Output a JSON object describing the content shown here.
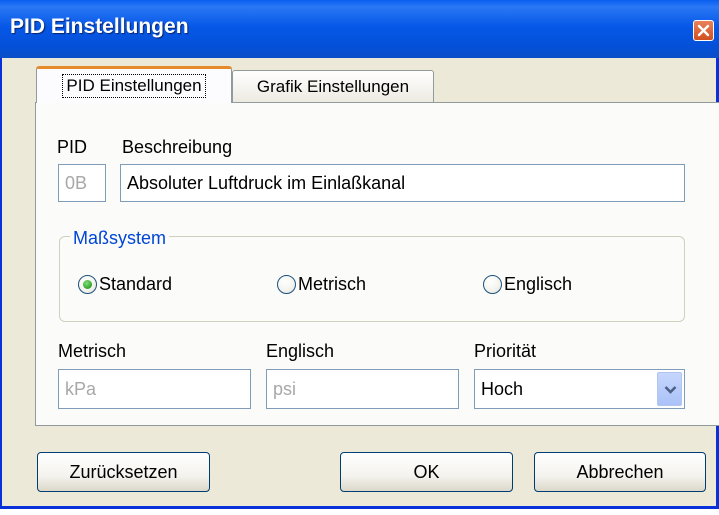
{
  "window": {
    "title": "PID Einstellungen"
  },
  "tabs": [
    {
      "label": "PID Einstellungen",
      "active": true
    },
    {
      "label": "Grafik Einstellungen",
      "active": false
    }
  ],
  "pid": {
    "label": "PID",
    "value": "0B"
  },
  "description": {
    "label": "Beschreibung",
    "value": "Absoluter Luftdruck im Einlaßkanal"
  },
  "measure_system": {
    "legend": "Maßsystem",
    "options": [
      {
        "label": "Standard",
        "selected": true
      },
      {
        "label": "Metrisch",
        "selected": false
      },
      {
        "label": "Englisch",
        "selected": false
      }
    ]
  },
  "units": {
    "metric_label": "Metrisch",
    "metric_value": "kPa",
    "english_label": "Englisch",
    "english_value": "psi"
  },
  "priority": {
    "label": "Priorität",
    "value": "Hoch"
  },
  "buttons": {
    "reset": "Zurücksetzen",
    "ok": "OK",
    "cancel": "Abbrechen"
  },
  "colors": {
    "titlebar": "#0758e8",
    "close": "#d04f20",
    "legend": "#0046d5",
    "active_tab_accent": "#e68b2c"
  }
}
